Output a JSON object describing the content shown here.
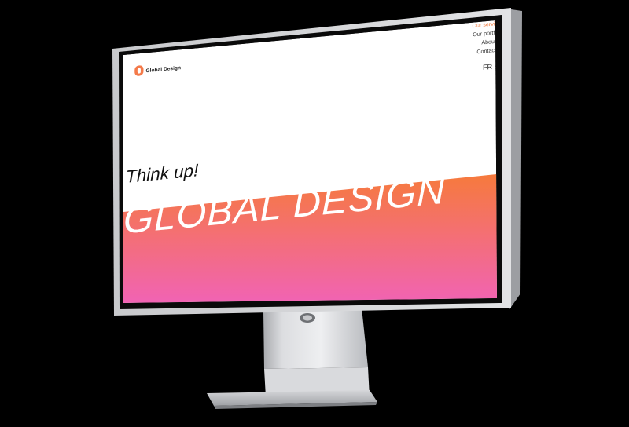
{
  "site": {
    "logo_text": "Global Design",
    "nav": {
      "services": "Our services",
      "portfolio": "Our portfolio",
      "about": "About us",
      "contact": "Contact us"
    },
    "languages": {
      "fr": "FR",
      "en": "EN"
    },
    "hero": {
      "tagline": "Think up!",
      "headline": "GLOBAL DESIGN"
    }
  },
  "colors": {
    "accent_orange": "#f67a3c",
    "accent_pink": "#f163b4",
    "active_nav": "#f07a3e"
  }
}
